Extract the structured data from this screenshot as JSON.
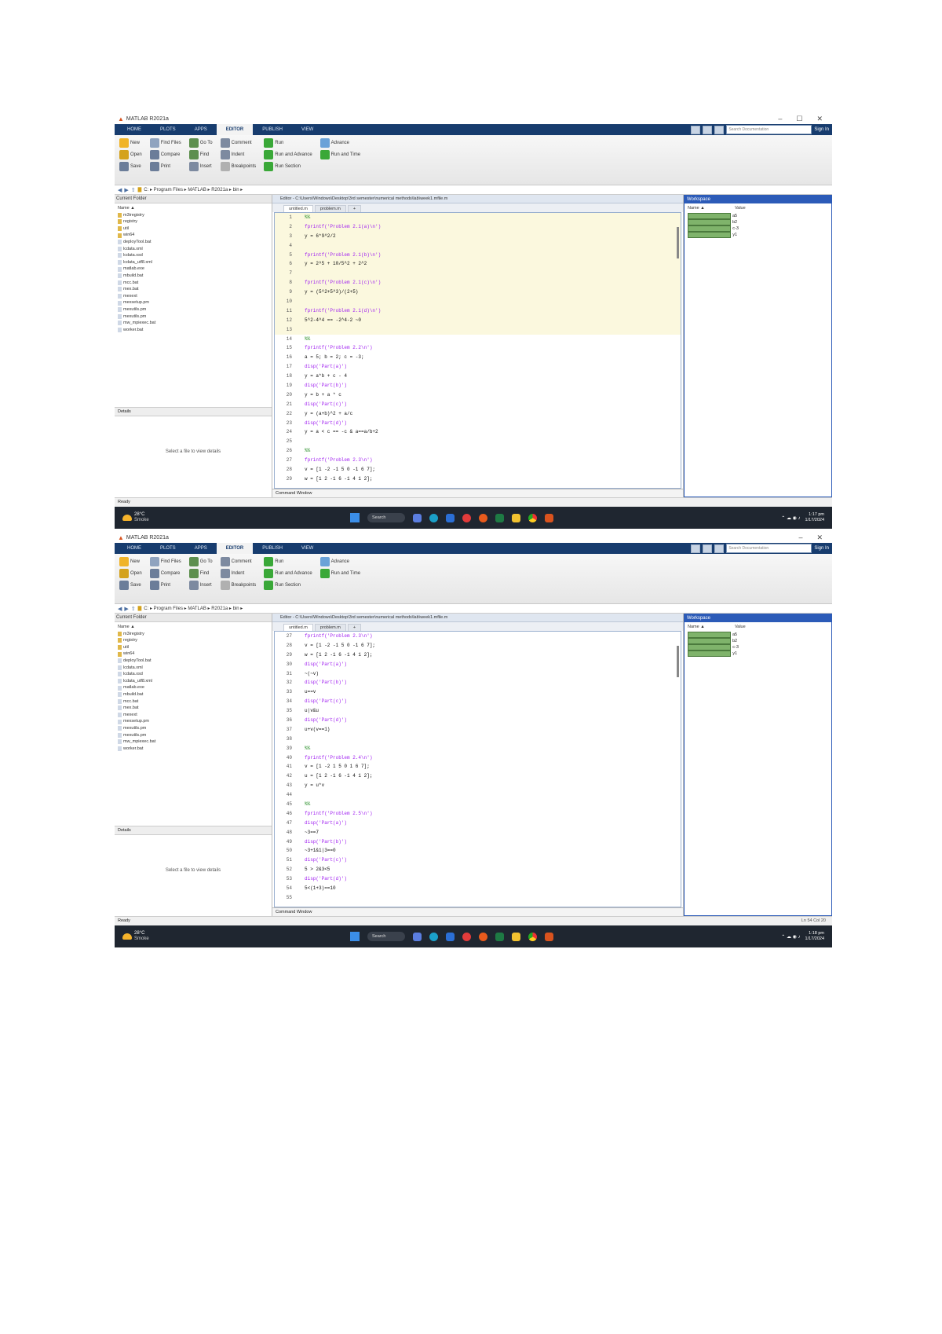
{
  "shots": [
    {
      "title": "MATLAB R2021a",
      "window_controls": [
        "–",
        "☐",
        "✕"
      ],
      "tabs": [
        "HOME",
        "PLOTS",
        "APPS",
        "EDITOR",
        "PUBLISH",
        "VIEW"
      ],
      "active_tab": "EDITOR",
      "search_placeholder": "Search Documentation",
      "sign_in": "Sign In",
      "ribbon": [
        "New",
        "Open",
        "Save",
        "Find Files",
        "Compare",
        "Print",
        "Go To",
        "Find",
        "Insert",
        "Comment",
        "Indent",
        "Breakpoints",
        "Run",
        "Run and Advance",
        "Run Section",
        "Advance",
        "Run and Time"
      ],
      "path": "C: ▸ Program Files ▸ MATLAB ▸ R2021a ▸ bin ▸",
      "current_folder_label": "Current Folder",
      "folder_header": "Name ▲",
      "files": [
        "m3iregistry",
        "registry",
        "util",
        "win64",
        "deployTool.bat",
        "lcdata.xml",
        "lcdata.xsd",
        "lcdata_utf8.xml",
        "matlab.exe",
        "mbuild.bat",
        "mcc.bat",
        "mex.bat",
        "mexext",
        "mexsetup.pm",
        "mexutils.pm",
        "mexutils.pm",
        "mw_mpiexec.bat",
        "worker.bat"
      ],
      "details_label": "Details",
      "details_msg": "Select a file to view details",
      "editor_title": "Editor - C:\\Users\\Windows\\Desktop\\3rd semester\\numerical methods\\lab\\week1.mfile.m",
      "editor_tabs": [
        "untitled.m",
        "problem.m",
        "+"
      ],
      "code_lines": [
        {
          "n": "1",
          "t": "%%",
          "cell": true
        },
        {
          "n": "2",
          "t": "fprintf('Problem 2.1(a)\\n')",
          "cell": true
        },
        {
          "n": "3",
          "t": "y = 6*9^2/2",
          "cell": true
        },
        {
          "n": "4",
          "t": "",
          "cell": true
        },
        {
          "n": "5",
          "t": "fprintf('Problem 2.1(b)\\n')",
          "cell": true
        },
        {
          "n": "6",
          "t": "y = 2^5 + 10/5^2 + 2^2",
          "cell": true
        },
        {
          "n": "7",
          "t": "",
          "cell": true
        },
        {
          "n": "8",
          "t": "fprintf('Problem 2.1(c)\\n')",
          "cell": true
        },
        {
          "n": "9",
          "t": "y = (5^2+5^3)/(2+5)",
          "cell": true
        },
        {
          "n": "10",
          "t": "",
          "cell": true
        },
        {
          "n": "11",
          "t": "fprintf('Problem 2.1(d)\\n')",
          "cell": true
        },
        {
          "n": "12",
          "t": "5^2-4^4 == -2^4-2 ~0",
          "cell": true
        },
        {
          "n": "13",
          "t": "",
          "cell": true
        },
        {
          "n": "14",
          "t": "%%",
          "cell": false
        },
        {
          "n": "15",
          "t": "fprintf('Problem 2.2\\n')",
          "cell": false
        },
        {
          "n": "16",
          "t": "a = 5; b = 2; c = -3;",
          "cell": false
        },
        {
          "n": "17",
          "t": "disp('Part(a)')",
          "cell": false
        },
        {
          "n": "18",
          "t": "y = a*b + c - 4",
          "cell": false
        },
        {
          "n": "19",
          "t": "disp('Part(b)')",
          "cell": false
        },
        {
          "n": "20",
          "t": "y = b + a * c",
          "cell": false
        },
        {
          "n": "21",
          "t": "disp('Part(c)')",
          "cell": false
        },
        {
          "n": "22",
          "t": "y = (a+b)^2 + a/c",
          "cell": false
        },
        {
          "n": "23",
          "t": "disp('Part(d)')",
          "cell": false
        },
        {
          "n": "24",
          "t": "y = a < c == -c & a==a/b+2",
          "cell": false
        },
        {
          "n": "25",
          "t": "",
          "cell": false
        },
        {
          "n": "26",
          "t": "%%",
          "cell": false
        },
        {
          "n": "27",
          "t": "fprintf('Problem 2.3\\n')",
          "cell": false
        },
        {
          "n": "28",
          "t": "v = [1 -2 -1 5 0 -1 6 7];",
          "cell": false
        },
        {
          "n": "29",
          "t": "w = [1 2 -1 6 -1 4 1 2];",
          "cell": false
        }
      ],
      "command_window_label": "Command Window",
      "workspace_label": "Workspace",
      "ws_cols": [
        "Name ▲",
        "Value"
      ],
      "ws_vars": [
        {
          "n": "a",
          "v": "5"
        },
        {
          "n": "b",
          "v": "2"
        },
        {
          "n": "c",
          "v": "-3"
        },
        {
          "n": "y",
          "v": "1"
        }
      ],
      "status": "Ready",
      "status_right": "",
      "weather_temp": "28°C",
      "weather_desc": "Smoke",
      "task_search": "Search",
      "clock_time": "1:17 pm",
      "clock_date": "1/17/2024"
    },
    {
      "title": "MATLAB R2021a",
      "window_controls": [
        "–",
        "✕"
      ],
      "tabs": [
        "HOME",
        "PLOTS",
        "APPS",
        "EDITOR",
        "PUBLISH",
        "VIEW"
      ],
      "active_tab": "EDITOR",
      "search_placeholder": "Search Documentation",
      "sign_in": "Sign In",
      "ribbon": [
        "New",
        "Open",
        "Save",
        "Find Files",
        "Compare",
        "Print",
        "Go To",
        "Find",
        "Insert",
        "Comment",
        "Indent",
        "Breakpoints",
        "Run",
        "Run and Advance",
        "Run Section",
        "Advance",
        "Run and Time"
      ],
      "path": "C: ▸ Program Files ▸ MATLAB ▸ R2021a ▸ bin ▸",
      "current_folder_label": "Current Folder",
      "folder_header": "Name ▲",
      "files": [
        "m3iregistry",
        "registry",
        "util",
        "win64",
        "deployTool.bat",
        "lcdata.xml",
        "lcdata.xsd",
        "lcdata_utf8.xml",
        "matlab.exe",
        "mbuild.bat",
        "mcc.bat",
        "mex.bat",
        "mexext",
        "mexsetup.pm",
        "mexutils.pm",
        "mexutils.pm",
        "mw_mpiexec.bat",
        "worker.bat"
      ],
      "details_label": "Details",
      "details_msg": "Select a file to view details",
      "editor_title": "Editor - C:\\Users\\Windows\\Desktop\\3rd semester\\numerical methods\\lab\\week1.mfile.m",
      "editor_tabs": [
        "untitled.m",
        "problem.m",
        "+"
      ],
      "code_lines": [
        {
          "n": "27",
          "t": "fprintf('Problem 2.3\\n')",
          "cell": false
        },
        {
          "n": "28",
          "t": "v = [1 -2 -1 5 0 -1 6 7];",
          "cell": false
        },
        {
          "n": "29",
          "t": "w = [1 2 -1 6 -1 4 1 2];",
          "cell": false
        },
        {
          "n": "30",
          "t": "disp('Part(a)')",
          "cell": false
        },
        {
          "n": "31",
          "t": "~(~v)",
          "cell": false
        },
        {
          "n": "32",
          "t": "disp('Part(b)')",
          "cell": false
        },
        {
          "n": "33",
          "t": "u==v",
          "cell": false
        },
        {
          "n": "34",
          "t": "disp('Part(c)')",
          "cell": false
        },
        {
          "n": "35",
          "t": "u|v&u",
          "cell": false
        },
        {
          "n": "36",
          "t": "disp('Part(d)')",
          "cell": false
        },
        {
          "n": "37",
          "t": "u+v(v==1)",
          "cell": false
        },
        {
          "n": "38",
          "t": "",
          "cell": false
        },
        {
          "n": "39",
          "t": "%%",
          "cell": false
        },
        {
          "n": "40",
          "t": "fprintf('Problem 2.4\\n')",
          "cell": false
        },
        {
          "n": "41",
          "t": "v = [1 -2 1 5 0 1 6 7];",
          "cell": false
        },
        {
          "n": "42",
          "t": "u = [1 2 -1 6 -1 4 1 2];",
          "cell": false
        },
        {
          "n": "43",
          "t": "y = u*v",
          "cell": false
        },
        {
          "n": "44",
          "t": "",
          "cell": false
        },
        {
          "n": "45",
          "t": "%%",
          "cell": false
        },
        {
          "n": "46",
          "t": "fprintf('Problem 2.5\\n')",
          "cell": false
        },
        {
          "n": "47",
          "t": "disp('Part(a)')",
          "cell": false
        },
        {
          "n": "48",
          "t": "~3==7",
          "cell": false
        },
        {
          "n": "49",
          "t": "disp('Part(b)')",
          "cell": false
        },
        {
          "n": "50",
          "t": "~3+1&1|3==0",
          "cell": false
        },
        {
          "n": "51",
          "t": "disp('Part(c)')",
          "cell": false
        },
        {
          "n": "52",
          "t": "5 > 2&3<5",
          "cell": false
        },
        {
          "n": "53",
          "t": "disp('Part(d)')",
          "cell": false
        },
        {
          "n": "54",
          "t": "5<(1+3)==10",
          "cell": false
        },
        {
          "n": "55",
          "t": "",
          "cell": false
        }
      ],
      "command_window_label": "Command Window",
      "workspace_label": "Workspace",
      "ws_cols": [
        "Name ▲",
        "Value"
      ],
      "ws_vars": [
        {
          "n": "a",
          "v": "5"
        },
        {
          "n": "b",
          "v": "2"
        },
        {
          "n": "c",
          "v": "-3"
        },
        {
          "n": "y",
          "v": "1"
        }
      ],
      "status": "Ready",
      "status_right": "Ln 54   Col 20",
      "weather_temp": "28°C",
      "weather_desc": "Smoke",
      "task_search": "Search",
      "clock_time": "1:18 pm",
      "clock_date": "1/17/2024"
    }
  ],
  "colors": {
    "tabbar": "#173c6e",
    "cell_highlight": "#fbf8de",
    "workspace_accent": "#2c5bb8",
    "taskbar": "#1f2630"
  },
  "icons": [
    "new-icon",
    "open-icon",
    "save-icon",
    "run-icon",
    "windows-logo-icon",
    "matlab-icon",
    "chrome-icon",
    "edge-icon"
  ]
}
